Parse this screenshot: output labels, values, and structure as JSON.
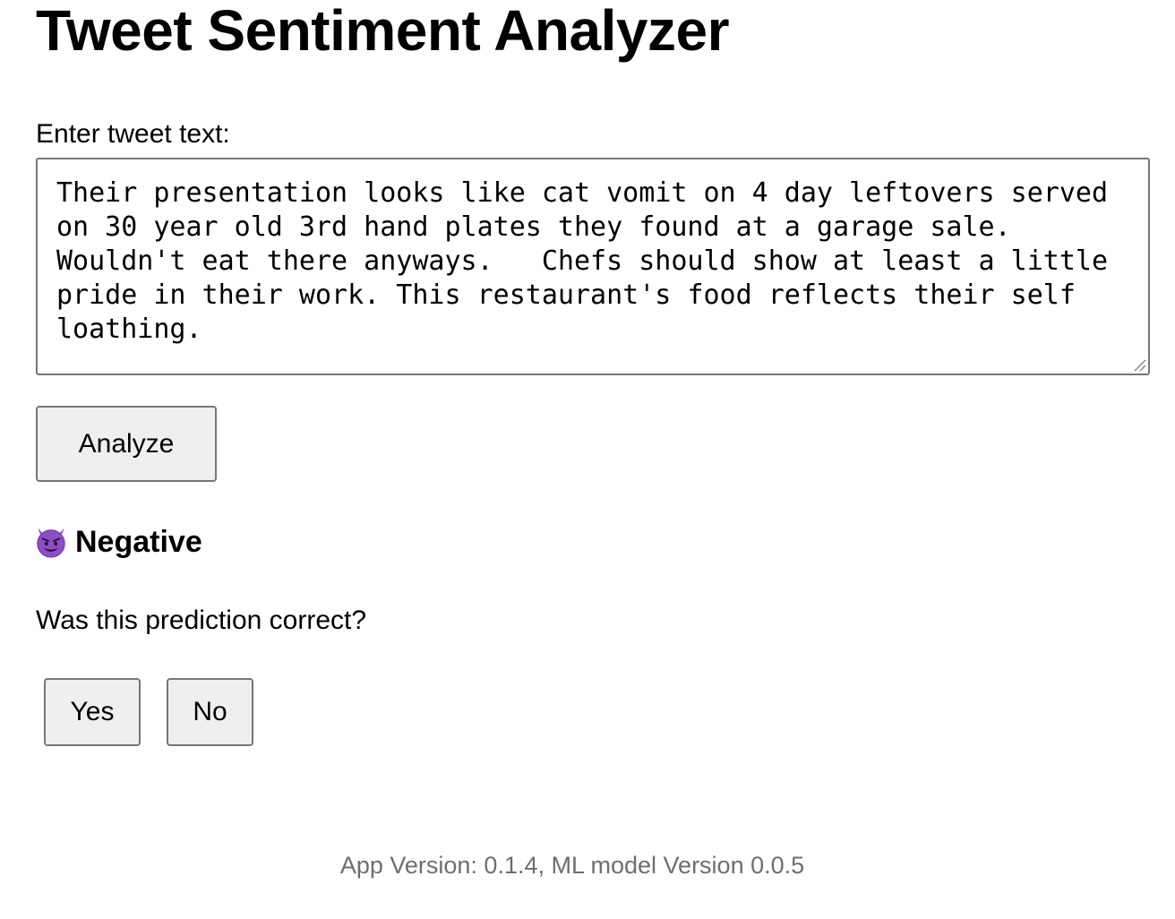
{
  "app": {
    "title": "Tweet Sentiment Analyzer"
  },
  "form": {
    "label": "Enter tweet text:",
    "tweet_value": "Their presentation looks like cat vomit on 4 day leftovers served on 30 year old 3rd hand plates they found at a garage sale.  Wouldn't eat there anyways.   Chefs should show at least a little pride in their work. This restaurant's food reflects their self loathing.",
    "analyze_label": "Analyze"
  },
  "result": {
    "icon": "smiling-devil-icon",
    "label": "Negative",
    "icon_color": "#7b3fb5"
  },
  "feedback": {
    "question": "Was this prediction correct?",
    "yes_label": "Yes",
    "no_label": "No"
  },
  "footer": {
    "version_text": "App Version: 0.1.4, ML model Version 0.0.5"
  }
}
